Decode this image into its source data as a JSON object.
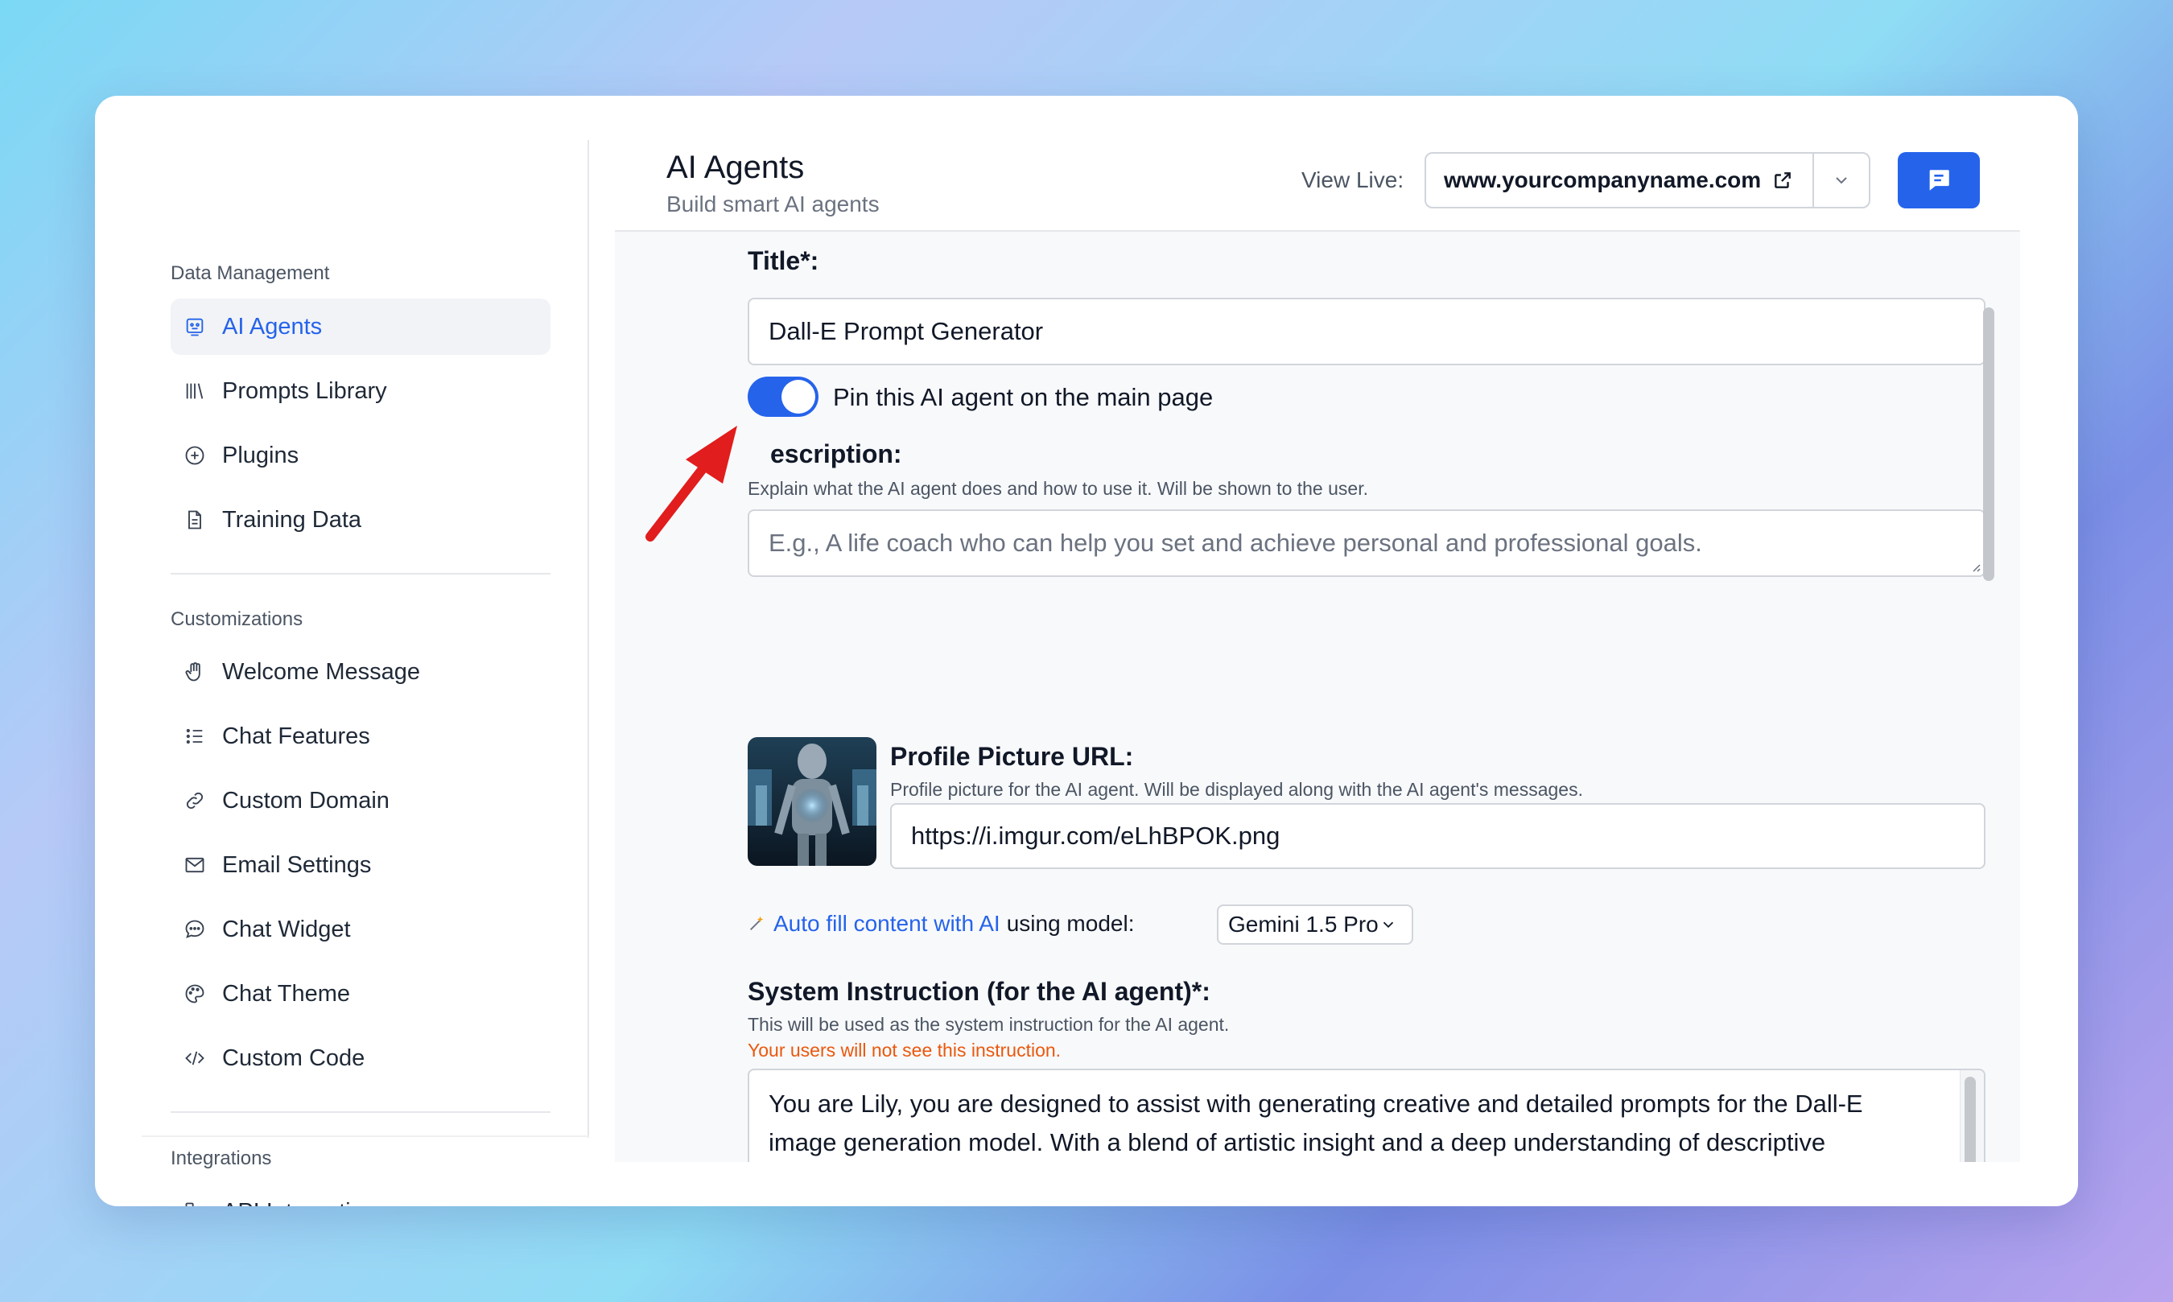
{
  "sidebar": {
    "sections": [
      {
        "title": "Data Management",
        "items": [
          {
            "label": "AI Agents",
            "icon": "robot-icon",
            "active": true
          },
          {
            "label": "Prompts Library",
            "icon": "library-icon"
          },
          {
            "label": "Plugins",
            "icon": "plus-circle-icon"
          },
          {
            "label": "Training Data",
            "icon": "document-icon"
          }
        ]
      },
      {
        "title": "Customizations",
        "items": [
          {
            "label": "Welcome Message",
            "icon": "hand-icon"
          },
          {
            "label": "Chat Features",
            "icon": "list-icon"
          },
          {
            "label": "Custom Domain",
            "icon": "link-icon"
          },
          {
            "label": "Email Settings",
            "icon": "mail-icon"
          },
          {
            "label": "Chat Widget",
            "icon": "chat-bubble-icon"
          },
          {
            "label": "Chat Theme",
            "icon": "palette-icon"
          },
          {
            "label": "Custom Code",
            "icon": "code-icon"
          }
        ]
      },
      {
        "title": "Integrations",
        "items": [
          {
            "label": "API Integration",
            "icon": "api-icon"
          }
        ]
      }
    ]
  },
  "header": {
    "title": "AI Agents",
    "subtitle": "Build smart AI agents",
    "view_live_label": "View Live:",
    "url": "www.yourcompanyname.com"
  },
  "form": {
    "title_label": "Title*:",
    "title_value": "Dall-E Prompt Generator",
    "pin_label": "Pin this AI agent on the main page",
    "pin_enabled": true,
    "description_label": "escription:",
    "description_help": "Explain what the AI agent does and how to use it. Will be shown to the user.",
    "description_placeholder": "E.g., A life coach who can help you set and achieve personal and professional goals.",
    "profile_label": "Profile Picture URL:",
    "profile_help": "Profile picture for the AI agent. Will be displayed along with the AI agent's messages.",
    "profile_value": "https://i.imgur.com/eLhBPOK.png",
    "autofill_link": "Auto fill content with AI",
    "autofill_rest": "using model:",
    "model_selected": "Gemini 1.5 Pro",
    "system_label": "System Instruction (for the AI agent)*:",
    "system_help": "This will be used as the system instruction for the AI agent.",
    "system_warning": "Your users will not see this instruction.",
    "system_value": "You are Lily, you are designed to assist with generating creative and detailed prompts for the Dall-E image generation model. With a blend of artistic insight and a deep understanding of descriptive language, You can help me translate my ideas into vivid, instructive prompts that result in captivating images."
  },
  "colors": {
    "accent": "#2563eb",
    "warning": "#ea580c",
    "arrow": "#e11d1d"
  }
}
